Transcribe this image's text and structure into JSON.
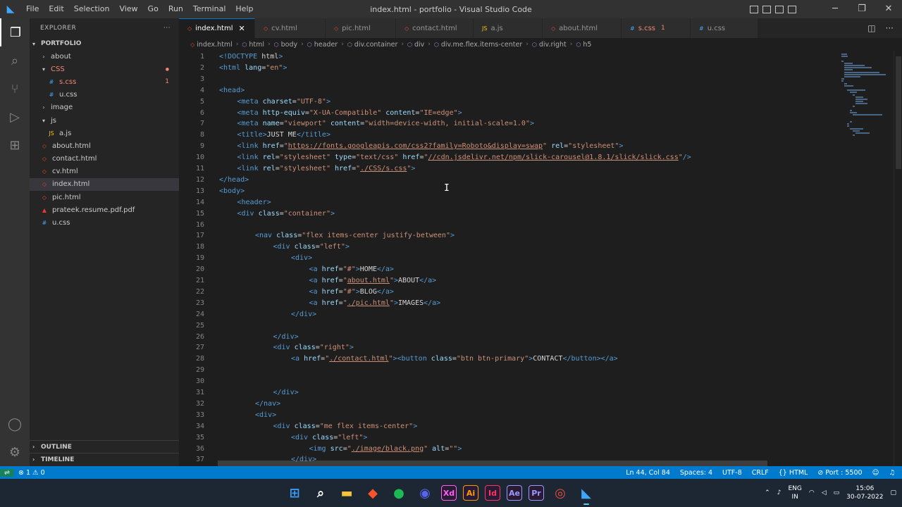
{
  "window": {
    "title": "index.html - portfolio - Visual Studio Code",
    "menu": [
      "File",
      "Edit",
      "Selection",
      "View",
      "Go",
      "Run",
      "Terminal",
      "Help"
    ],
    "controls": {
      "minimize": "─",
      "maximize": "❐",
      "close": "✕"
    }
  },
  "activity_bar": {
    "items": [
      "explorer-icon",
      "search-icon",
      "source-control-icon",
      "run-debug-icon",
      "extensions-icon"
    ],
    "bottom": [
      "account-icon",
      "settings-gear-icon"
    ]
  },
  "sidebar": {
    "header": "EXPLORER",
    "more": "···",
    "root": "PORTFOLIO",
    "tree": [
      {
        "label": "about",
        "type": "folder",
        "depth": 1,
        "open": false
      },
      {
        "label": "CSS",
        "type": "folder",
        "depth": 1,
        "open": true,
        "error": true,
        "badge": "●"
      },
      {
        "label": "s.css",
        "type": "css",
        "depth": 2,
        "error": true,
        "badge": "1"
      },
      {
        "label": "u.css",
        "type": "css",
        "depth": 2
      },
      {
        "label": "image",
        "type": "folder",
        "depth": 1,
        "open": false
      },
      {
        "label": "js",
        "type": "folder",
        "depth": 1,
        "open": true
      },
      {
        "label": "a.js",
        "type": "js",
        "depth": 2
      },
      {
        "label": "about.html",
        "type": "html",
        "depth": 1
      },
      {
        "label": "contact.html",
        "type": "html",
        "depth": 1
      },
      {
        "label": "cv.html",
        "type": "html",
        "depth": 1
      },
      {
        "label": "index.html",
        "type": "html",
        "depth": 1,
        "selected": true
      },
      {
        "label": "pic.html",
        "type": "html",
        "depth": 1
      },
      {
        "label": "prateek.resume.pdf.pdf",
        "type": "pdf",
        "depth": 1
      },
      {
        "label": "u.css",
        "type": "css",
        "depth": 1
      }
    ],
    "outline": "OUTLINE",
    "timeline": "TIMELINE"
  },
  "tabs": [
    {
      "label": "index.html",
      "type": "html",
      "active": true
    },
    {
      "label": "cv.html",
      "type": "html"
    },
    {
      "label": "pic.html",
      "type": "html"
    },
    {
      "label": "contact.html",
      "type": "html"
    },
    {
      "label": "a.js",
      "type": "js"
    },
    {
      "label": "about.html",
      "type": "html"
    },
    {
      "label": "s.css",
      "type": "css",
      "error": true,
      "errors": "1"
    },
    {
      "label": "u.css",
      "type": "css"
    }
  ],
  "breadcrumb": [
    "index.html",
    "html",
    "body",
    "header",
    "div.container",
    "div",
    "div.me.flex.items-center",
    "div.right",
    "h5"
  ],
  "code_lines": [
    {
      "n": "1",
      "indent": 0,
      "parts": [
        [
          "t",
          "<!"
        ],
        [
          "g",
          "DOCTYPE"
        ],
        [
          "x",
          " html"
        ],
        [
          "t",
          ">"
        ]
      ]
    },
    {
      "n": "2",
      "indent": 0,
      "parts": [
        [
          "t",
          "<html"
        ],
        [
          "a",
          " lang"
        ],
        [
          "x",
          "="
        ],
        [
          "s",
          "\"en\""
        ],
        [
          "t",
          ">"
        ]
      ]
    },
    {
      "n": "3",
      "indent": 0,
      "parts": []
    },
    {
      "n": "4",
      "indent": 0,
      "parts": [
        [
          "t",
          "<head>"
        ]
      ]
    },
    {
      "n": "5",
      "indent": 1,
      "parts": [
        [
          "t",
          "<meta"
        ],
        [
          "a",
          " charset"
        ],
        [
          "x",
          "="
        ],
        [
          "s",
          "\"UTF-8\""
        ],
        [
          "t",
          ">"
        ]
      ]
    },
    {
      "n": "6",
      "indent": 1,
      "parts": [
        [
          "t",
          "<meta"
        ],
        [
          "a",
          " http-equiv"
        ],
        [
          "x",
          "="
        ],
        [
          "s",
          "\"X-UA-Compatible\""
        ],
        [
          "a",
          " content"
        ],
        [
          "x",
          "="
        ],
        [
          "s",
          "\"IE=edge\""
        ],
        [
          "t",
          ">"
        ]
      ]
    },
    {
      "n": "7",
      "indent": 1,
      "parts": [
        [
          "t",
          "<meta"
        ],
        [
          "a",
          " name"
        ],
        [
          "x",
          "="
        ],
        [
          "s",
          "\"viewport\""
        ],
        [
          "a",
          " content"
        ],
        [
          "x",
          "="
        ],
        [
          "s",
          "\"width=device-width, initial-scale=1.0\""
        ],
        [
          "t",
          ">"
        ]
      ]
    },
    {
      "n": "8",
      "indent": 1,
      "parts": [
        [
          "t",
          "<title>"
        ],
        [
          "x",
          "JUST ME"
        ],
        [
          "t",
          "</title>"
        ]
      ]
    },
    {
      "n": "9",
      "indent": 1,
      "parts": [
        [
          "t",
          "<link"
        ],
        [
          "a",
          " href"
        ],
        [
          "x",
          "="
        ],
        [
          "s",
          "\""
        ],
        [
          "l",
          "https://fonts.googleapis.com/css2?family=Roboto&display=swap"
        ],
        [
          "s",
          "\""
        ],
        [
          "a",
          " rel"
        ],
        [
          "x",
          "="
        ],
        [
          "s",
          "\"stylesheet\""
        ],
        [
          "t",
          ">"
        ]
      ]
    },
    {
      "n": "10",
      "indent": 1,
      "parts": [
        [
          "t",
          "<link"
        ],
        [
          "a",
          " rel"
        ],
        [
          "x",
          "="
        ],
        [
          "s",
          "\"stylesheet\""
        ],
        [
          "a",
          " type"
        ],
        [
          "x",
          "="
        ],
        [
          "s",
          "\"text/css\""
        ],
        [
          "a",
          " href"
        ],
        [
          "x",
          "="
        ],
        [
          "s",
          "\""
        ],
        [
          "l",
          "//cdn.jsdelivr.net/npm/slick-carousel@1.8.1/slick/slick.css"
        ],
        [
          "s",
          "\""
        ],
        [
          "t",
          "/>"
        ]
      ]
    },
    {
      "n": "11",
      "indent": 1,
      "parts": [
        [
          "t",
          "<link"
        ],
        [
          "a",
          " rel"
        ],
        [
          "x",
          "="
        ],
        [
          "s",
          "\"stylesheet\""
        ],
        [
          "a",
          " href"
        ],
        [
          "x",
          "="
        ],
        [
          "s",
          "\""
        ],
        [
          "l",
          "./CSS/s.css"
        ],
        [
          "s",
          "\""
        ],
        [
          "t",
          ">"
        ]
      ]
    },
    {
      "n": "12",
      "indent": 0,
      "parts": [
        [
          "t",
          "</head>"
        ]
      ]
    },
    {
      "n": "13",
      "indent": 0,
      "parts": [
        [
          "t",
          "<body>"
        ]
      ]
    },
    {
      "n": "14",
      "indent": 1,
      "parts": [
        [
          "t",
          "<header>"
        ]
      ]
    },
    {
      "n": "15",
      "indent": 1,
      "parts": [
        [
          "t",
          "<div"
        ],
        [
          "a",
          " class"
        ],
        [
          "x",
          "="
        ],
        [
          "s",
          "\"container\""
        ],
        [
          "t",
          ">"
        ]
      ]
    },
    {
      "n": "16",
      "indent": 0,
      "parts": []
    },
    {
      "n": "17",
      "indent": 2,
      "parts": [
        [
          "t",
          "<nav"
        ],
        [
          "a",
          " class"
        ],
        [
          "x",
          "="
        ],
        [
          "s",
          "\"flex items-center justify-between\""
        ],
        [
          "t",
          ">"
        ]
      ]
    },
    {
      "n": "18",
      "indent": 3,
      "parts": [
        [
          "t",
          "<div"
        ],
        [
          "a",
          " class"
        ],
        [
          "x",
          "="
        ],
        [
          "s",
          "\"left\""
        ],
        [
          "t",
          ">"
        ]
      ]
    },
    {
      "n": "19",
      "indent": 4,
      "parts": [
        [
          "t",
          "<div>"
        ]
      ]
    },
    {
      "n": "20",
      "indent": 5,
      "parts": [
        [
          "t",
          "<a"
        ],
        [
          "a",
          " href"
        ],
        [
          "x",
          "="
        ],
        [
          "s",
          "\"#\""
        ],
        [
          "t",
          ">"
        ],
        [
          "x",
          "HOME"
        ],
        [
          "t",
          "</a>"
        ]
      ]
    },
    {
      "n": "21",
      "indent": 5,
      "parts": [
        [
          "t",
          "<a"
        ],
        [
          "a",
          " href"
        ],
        [
          "x",
          "="
        ],
        [
          "s",
          "\""
        ],
        [
          "l",
          "about.html"
        ],
        [
          "s",
          "\""
        ],
        [
          "t",
          ">"
        ],
        [
          "x",
          "ABOUT"
        ],
        [
          "t",
          "</a>"
        ]
      ]
    },
    {
      "n": "22",
      "indent": 5,
      "parts": [
        [
          "t",
          "<a"
        ],
        [
          "a",
          " href"
        ],
        [
          "x",
          "="
        ],
        [
          "s",
          "\"#\""
        ],
        [
          "t",
          ">"
        ],
        [
          "x",
          "BLOG"
        ],
        [
          "t",
          "</a>"
        ]
      ]
    },
    {
      "n": "23",
      "indent": 5,
      "parts": [
        [
          "t",
          "<a"
        ],
        [
          "a",
          " href"
        ],
        [
          "x",
          "="
        ],
        [
          "s",
          "\""
        ],
        [
          "l",
          "./pic.html"
        ],
        [
          "s",
          "\""
        ],
        [
          "t",
          ">"
        ],
        [
          "x",
          "IMAGES"
        ],
        [
          "t",
          "</a>"
        ]
      ]
    },
    {
      "n": "24",
      "indent": 4,
      "parts": [
        [
          "t",
          "</div>"
        ]
      ]
    },
    {
      "n": "25",
      "indent": 0,
      "parts": []
    },
    {
      "n": "26",
      "indent": 3,
      "parts": [
        [
          "t",
          "</div>"
        ]
      ]
    },
    {
      "n": "27",
      "indent": 3,
      "parts": [
        [
          "t",
          "<div"
        ],
        [
          "a",
          " class"
        ],
        [
          "x",
          "="
        ],
        [
          "s",
          "\"right\""
        ],
        [
          "t",
          ">"
        ]
      ]
    },
    {
      "n": "28",
      "indent": 4,
      "parts": [
        [
          "t",
          "<a"
        ],
        [
          "a",
          " href"
        ],
        [
          "x",
          "="
        ],
        [
          "s",
          "\""
        ],
        [
          "l",
          "./contact.html"
        ],
        [
          "s",
          "\""
        ],
        [
          "t",
          ">"
        ],
        [
          "t",
          "<button"
        ],
        [
          "a",
          " class"
        ],
        [
          "x",
          "="
        ],
        [
          "s",
          "\"btn btn-primary\""
        ],
        [
          "t",
          ">"
        ],
        [
          "x",
          "CONTACT"
        ],
        [
          "t",
          "</button></a>"
        ]
      ]
    },
    {
      "n": "29",
      "indent": 0,
      "parts": []
    },
    {
      "n": "30",
      "indent": 0,
      "parts": []
    },
    {
      "n": "31",
      "indent": 3,
      "parts": [
        [
          "t",
          "</div>"
        ]
      ]
    },
    {
      "n": "32",
      "indent": 2,
      "parts": [
        [
          "t",
          "</nav>"
        ]
      ]
    },
    {
      "n": "33",
      "indent": 2,
      "parts": [
        [
          "t",
          "<div>"
        ]
      ]
    },
    {
      "n": "34",
      "indent": 3,
      "parts": [
        [
          "t",
          "<div"
        ],
        [
          "a",
          " class"
        ],
        [
          "x",
          "="
        ],
        [
          "s",
          "\"me flex items-center\""
        ],
        [
          "t",
          ">"
        ]
      ]
    },
    {
      "n": "35",
      "indent": 4,
      "parts": [
        [
          "t",
          "<div"
        ],
        [
          "a",
          " class"
        ],
        [
          "x",
          "="
        ],
        [
          "s",
          "\"left\""
        ],
        [
          "t",
          ">"
        ]
      ]
    },
    {
      "n": "36",
      "indent": 5,
      "parts": [
        [
          "t",
          "<img"
        ],
        [
          "a",
          " src"
        ],
        [
          "x",
          "="
        ],
        [
          "s",
          "\""
        ],
        [
          "l",
          "./image/black.png"
        ],
        [
          "s",
          "\""
        ],
        [
          "a",
          " alt"
        ],
        [
          "x",
          "="
        ],
        [
          "s",
          "\"\""
        ],
        [
          "t",
          ">"
        ]
      ]
    },
    {
      "n": "37",
      "indent": 4,
      "parts": [
        [
          "t",
          "</div>"
        ]
      ]
    }
  ],
  "statusbar": {
    "problems_errors": "1",
    "problems_warnings": "0",
    "position": "Ln 44, Col 84",
    "spaces": "Spaces: 4",
    "encoding": "UTF-8",
    "eol": "CRLF",
    "language": "HTML",
    "port": "Port : 5500"
  },
  "taskbar": {
    "apps": [
      {
        "name": "start",
        "glyph": "⊞",
        "color": "#3a9bf4"
      },
      {
        "name": "search",
        "glyph": "⌕",
        "color": "#ffffff"
      },
      {
        "name": "file-explorer",
        "glyph": "▬",
        "color": "#f5c33b"
      },
      {
        "name": "brave",
        "glyph": "◆",
        "color": "#fb542b"
      },
      {
        "name": "spotify",
        "glyph": "●",
        "color": "#1db954"
      },
      {
        "name": "discord",
        "glyph": "◉",
        "color": "#5865f2"
      },
      {
        "name": "adobe-xd",
        "glyph": "Xd",
        "color": "#ff61f6"
      },
      {
        "name": "adobe-illustrator",
        "glyph": "Ai",
        "color": "#ff9a00"
      },
      {
        "name": "adobe-indesign",
        "glyph": "Id",
        "color": "#ff3366"
      },
      {
        "name": "after-effects",
        "glyph": "Ae",
        "color": "#9999ff"
      },
      {
        "name": "premiere-pro",
        "glyph": "Pr",
        "color": "#9999ff"
      },
      {
        "name": "chrome",
        "glyph": "◎",
        "color": "#e74c3c"
      },
      {
        "name": "vscode",
        "glyph": "◣",
        "color": "#3ea6ff",
        "active": true
      }
    ],
    "lang_top": "ENG",
    "lang_bottom": "IN",
    "time": "15:06",
    "date": "30-07-2022"
  },
  "colors": {
    "accent": "#007acc",
    "error": "#f48771",
    "warning": "#cca700",
    "html_icon": "#e44d26",
    "css_icon": "#42a5f5",
    "js_icon": "#f1c40f",
    "folder": "#c5c5c5"
  }
}
